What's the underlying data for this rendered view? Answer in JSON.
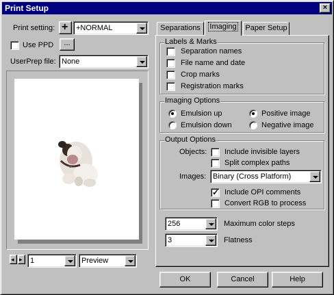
{
  "window": {
    "title": "Print Setup",
    "close_glyph": "×"
  },
  "left": {
    "print_setting_label": "Print setting:",
    "print_setting_value": "+NORMAL",
    "add_glyph": "+",
    "use_ppd_label": "Use PPD",
    "use_ppd_checked": false,
    "ppd_browse_label": "...",
    "userprep_label": "UserPrep file:",
    "userprep_value": "None",
    "page_value": "1",
    "view_value": "Preview"
  },
  "tabs": [
    {
      "label": "Separations",
      "active": false
    },
    {
      "label": "Imaging",
      "active": true
    },
    {
      "label": "Paper Setup",
      "active": false
    }
  ],
  "labels_marks": {
    "title": "Labels & Marks",
    "items": [
      {
        "label": "Separation names",
        "checked": false
      },
      {
        "label": "File name and date",
        "checked": false
      },
      {
        "label": "Crop marks",
        "checked": false
      },
      {
        "label": "Registration marks",
        "checked": false
      }
    ]
  },
  "imaging_options": {
    "title": "Imaging Options",
    "emulsion_up": "Emulsion up",
    "emulsion_down": "Emulsion down",
    "positive_image": "Positive image",
    "negative_image": "Negative image",
    "emulsion_selected": "up",
    "image_selected": "positive"
  },
  "output_options": {
    "title": "Output Options",
    "objects_label": "Objects:",
    "include_invisible": "Include invisible layers",
    "split_paths": "Split complex paths",
    "images_label": "Images:",
    "images_value": "Binary (Cross Platform)",
    "include_opi": "Include OPI comments",
    "include_opi_checked": true,
    "convert_rgb": "Convert RGB to process",
    "convert_rgb_checked": false
  },
  "max_color_steps": {
    "value": "256",
    "label": "Maximum color steps"
  },
  "flatness": {
    "value": "3",
    "label": "Flatness"
  },
  "buttons": {
    "ok": "OK",
    "cancel": "Cancel",
    "help": "Help"
  },
  "check_glyph": "✓"
}
